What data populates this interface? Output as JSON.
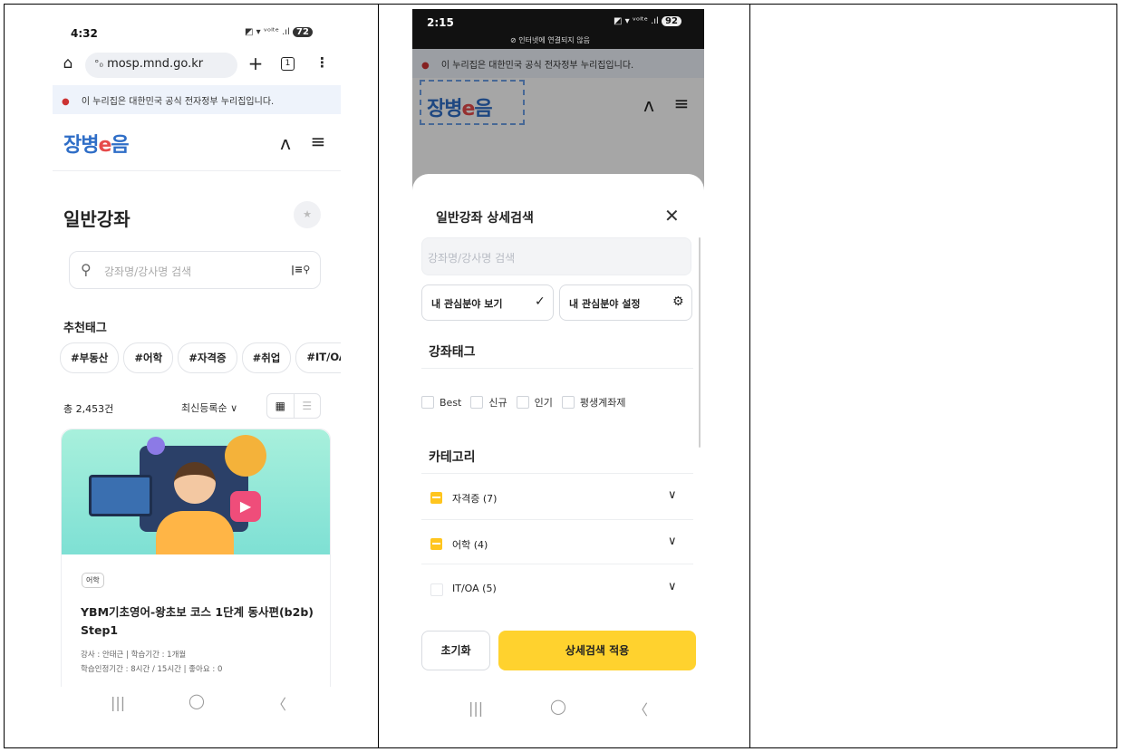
{
  "phone1": {
    "status": {
      "time": "4:32",
      "battery": "72"
    },
    "url": "mosp.mnd.go.kr",
    "tab_count": "1",
    "gov_notice": "이 누리집은 대한민국 공식 전자정부 누리집입니다.",
    "logo": {
      "main": "장병",
      "e": "e",
      "tail": "음"
    },
    "page_title": "일반강좌",
    "search_placeholder": "강좌명/강사명 검색",
    "recommended_tags_title": "추천태그",
    "tags": [
      "#부동산",
      "#어학",
      "#자격증",
      "#취업",
      "#IT/OA"
    ],
    "total_count": "총 2,453건",
    "sort_label": "최신등록순",
    "course": {
      "category": "어학",
      "title": "YBM기초영어-왕초보 코스 1단계 동사편(b2b) Step1",
      "meta1": "강사 : 안태근  |  학습기간 : 1개월",
      "meta2": "학습인정기간 : 8시간 / 15시간  |  좋아요 : 0"
    }
  },
  "phone2": {
    "status": {
      "time": "2:15",
      "battery": "92",
      "offline": "인터넷에 연결되지 않음"
    },
    "gov_notice": "이 누리집은 대한민국 공식 전자정부 누리집입니다.",
    "logo": {
      "main": "장병",
      "e": "e",
      "tail": "음"
    },
    "sheet_title": "일반강좌 상세검색",
    "search_placeholder": "강좌명/강사명 검색",
    "btn_view_interest": "내 관심분야 보기",
    "btn_set_interest": "내 관심분야 설정",
    "tags_title": "강좌태그",
    "tag_options": [
      "Best",
      "신규",
      "인기",
      "평생계좌제"
    ],
    "category_title": "카테고리",
    "categories": [
      {
        "label": "자격증 (7)",
        "state": "partial"
      },
      {
        "label": "어학 (4)",
        "state": "partial"
      },
      {
        "label": "IT/OA (5)",
        "state": "none"
      }
    ],
    "reset_label": "초기화",
    "apply_label": "상세검색 적용"
  },
  "colors": {
    "accent": "#ffd22e",
    "logo_blue": "#2f6ec7",
    "logo_red": "#e64a4a"
  }
}
